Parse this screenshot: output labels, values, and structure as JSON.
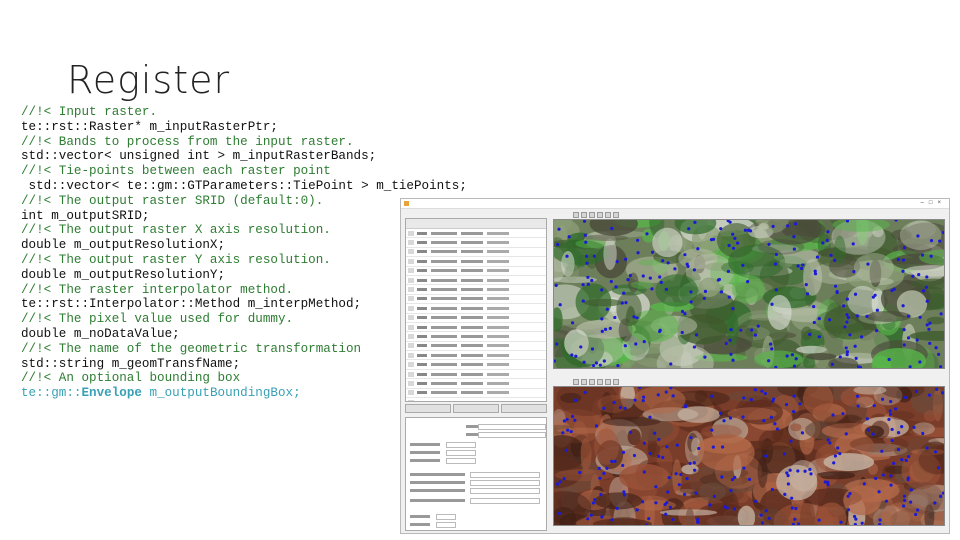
{
  "slide": {
    "title": "Register"
  },
  "code_lines": [
    {
      "type": "comment",
      "text": "//!< Input raster."
    },
    {
      "type": "stmt",
      "text": "te::rst::Raster* m_inputRasterPtr;"
    },
    {
      "type": "comment",
      "text": "//!< Bands to process from the input raster."
    },
    {
      "type": "stmt",
      "text": "std::vector< unsigned int > m_inputRasterBands;"
    },
    {
      "type": "comment",
      "text": "//!< Tie-points between each raster point"
    },
    {
      "type": "stmt",
      "text": " std::vector< te::gm::GTParameters::TiePoint > m_tiePoints;"
    },
    {
      "type": "comment",
      "text": "//!< The output raster SRID (default:0)."
    },
    {
      "type": "stmt",
      "text": "int m_outputSRID;"
    },
    {
      "type": "comment",
      "text": "//!< The output raster X axis resolution."
    },
    {
      "type": "stmt",
      "text": "double m_outputResolutionX;"
    },
    {
      "type": "comment",
      "text": "//!< The output raster Y axis resolution."
    },
    {
      "type": "stmt",
      "text": "double m_outputResolutionY;"
    },
    {
      "type": "comment",
      "text": "//!< The raster interpolator method."
    },
    {
      "type": "stmt",
      "text": "te::rst::Interpolator::Method m_interpMethod;"
    },
    {
      "type": "comment",
      "text": "//!< The pixel value used for dummy."
    },
    {
      "type": "stmt",
      "text": "double m_noDataValue;"
    },
    {
      "type": "comment",
      "text": "//!< The name of the geometric transformation"
    },
    {
      "type": "stmt",
      "text": "std::string m_geomTransfName;"
    },
    {
      "type": "comment",
      "text": "//!< An optional bounding box"
    }
  ],
  "last_line": {
    "prefix": "te::gm::",
    "type_name": "Envelope",
    "member": " m_outputBoundingBox;"
  },
  "colors": {
    "comment": "#2e7d32",
    "keyword_highlight": "#3aa0b5",
    "tie_point": "#1b1bd6"
  }
}
